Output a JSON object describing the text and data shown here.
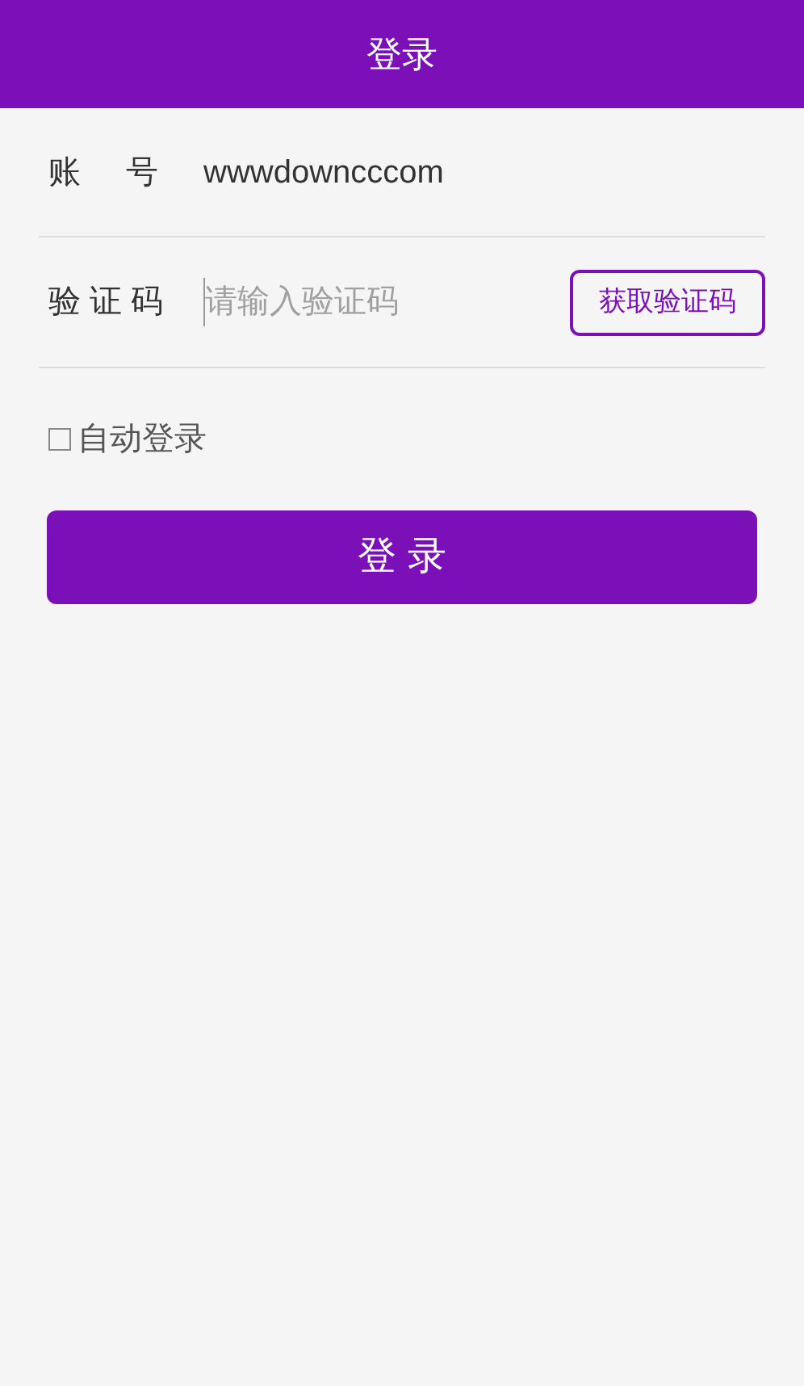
{
  "header": {
    "title": "登录"
  },
  "account": {
    "label": "账     号",
    "value": "wwwdowncccom"
  },
  "code": {
    "label": "验 证 码",
    "placeholder": "请输入验证码",
    "button": "获取验证码"
  },
  "auto_login": {
    "label": "自动登录",
    "checked": false
  },
  "submit": "登 录"
}
